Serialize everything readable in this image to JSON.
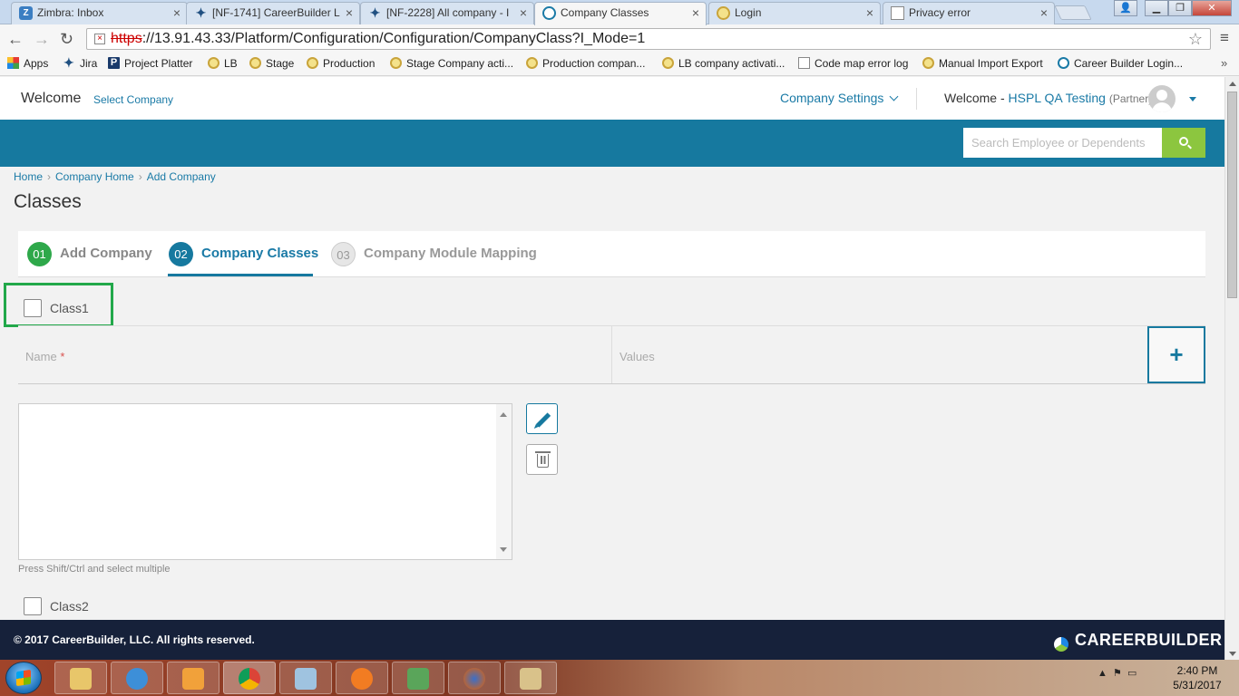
{
  "browser": {
    "tabs": [
      {
        "label": "Zimbra: Inbox",
        "active": false
      },
      {
        "label": "[NF-1741] CareerBuilder L",
        "active": false
      },
      {
        "label": "[NF-2228] All company - I",
        "active": false
      },
      {
        "label": "Company Classes",
        "active": true
      },
      {
        "label": "Login",
        "active": false
      },
      {
        "label": "Privacy error",
        "active": false
      }
    ],
    "url_scheme": "https",
    "url_rest": "://13.91.43.33/Platform/Configuration/Configuration/CompanyClass?I_Mode=1",
    "bookmarks": [
      "Apps",
      "Jira",
      "Project Platter",
      "LB",
      "Stage",
      "Production",
      "Stage Company acti...",
      "Production compan...",
      "LB company activati...",
      "Code map error log",
      "Manual Import Export",
      "Career Builder Login..."
    ]
  },
  "header": {
    "welcome": "Welcome",
    "select_company": "Select Company",
    "company_settings": "Company Settings",
    "welcome_prefix": "Welcome -",
    "user_name": "HSPL QA Testing",
    "user_role": "(Partner)"
  },
  "search": {
    "placeholder": "Search Employee or Dependents"
  },
  "breadcrumb": [
    "Home",
    "Company Home",
    "Add Company"
  ],
  "page_title": "Classes",
  "steps": [
    {
      "num": "01",
      "label": "Add Company",
      "state": "done"
    },
    {
      "num": "02",
      "label": "Company Classes",
      "state": "active"
    },
    {
      "num": "03",
      "label": "Company Module Mapping",
      "state": "todo"
    }
  ],
  "classes": [
    {
      "label": "Class1",
      "checked": false
    },
    {
      "label": "Class2",
      "checked": false
    }
  ],
  "form": {
    "name_label": "Name",
    "required_mark": "*",
    "values_label": "Values",
    "add_label": "+",
    "hint": "Press Shift/Ctrl and select multiple"
  },
  "footer": {
    "copyright": "© 2017 CareerBuilder, LLC. All rights reserved.",
    "brand": "CAREERBUILDER"
  },
  "taskbar": {
    "time": "2:40 PM",
    "date": "5/31/2017"
  },
  "colors": {
    "primary": "#16799f",
    "success": "#2ea84a",
    "accent_green": "#8cc63f",
    "footer_bg": "#16213a"
  }
}
